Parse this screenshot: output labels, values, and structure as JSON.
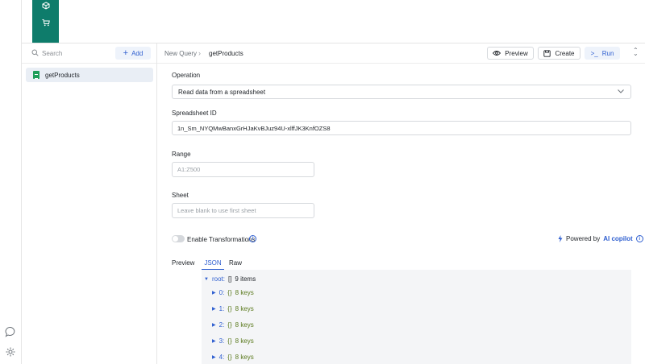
{
  "rail": {
    "icons": [
      "cube-icon",
      "cart-icon"
    ],
    "bottom_icons": [
      "chat-icon",
      "gear-icon"
    ]
  },
  "sidebar": {
    "search": {
      "placeholder": "Search",
      "value": ""
    },
    "add_label": "Add",
    "queries": [
      {
        "name": "getProducts",
        "icon": "sheets-icon",
        "color": "#1e9e5a"
      }
    ]
  },
  "header": {
    "breadcrumb_root": "New Query",
    "breadcrumb_current": "getProducts",
    "preview_label": "Preview",
    "create_label": "Create",
    "run_label": "Run"
  },
  "form": {
    "operation_label": "Operation",
    "operation_value": "Read data from a spreadsheet",
    "spreadsheet_label": "Spreadsheet ID",
    "spreadsheet_value": "1n_Sm_NYQMwBanxGrHJaKvBJuz94U-xlffJK3KnfOZS8",
    "range_label": "Range",
    "range_placeholder": "A1:Z500",
    "sheet_label": "Sheet",
    "sheet_placeholder": "Leave blank to use first sheet",
    "transform_label": "Enable Transformations",
    "transform_enabled": false,
    "copilot_prefix": "Powered by",
    "copilot_name": "AI copilot"
  },
  "preview": {
    "label": "Preview",
    "tabs": [
      "JSON",
      "Raw"
    ],
    "active_tab": "JSON",
    "root": {
      "key": "root:",
      "type": "[]",
      "count": "9 items"
    },
    "items": [
      {
        "key": "0:",
        "type": "{}",
        "count": "8 keys"
      },
      {
        "key": "1:",
        "type": "{}",
        "count": "8 keys"
      },
      {
        "key": "2:",
        "type": "{}",
        "count": "8 keys"
      },
      {
        "key": "3:",
        "type": "{}",
        "count": "8 keys"
      },
      {
        "key": "4:",
        "type": "{}",
        "count": "8 keys"
      }
    ]
  },
  "colors": {
    "accent": "#2f5fd0",
    "brand": "#0e7c6b",
    "sheets": "#1e9e5a"
  }
}
